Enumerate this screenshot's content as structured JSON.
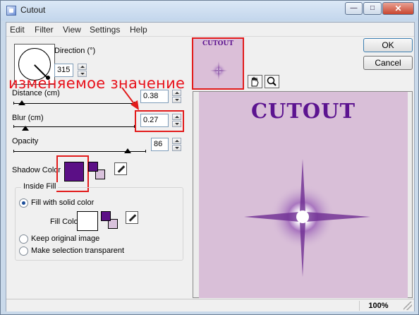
{
  "window": {
    "title": "Cutout"
  },
  "menu": [
    "Edit",
    "Filter",
    "View",
    "Settings",
    "Help"
  ],
  "direction": {
    "label": "Direction (°)",
    "value": "315"
  },
  "annotation": "изменяемое значение",
  "distance": {
    "label": "Distance (cm)",
    "value": "0.38"
  },
  "blur": {
    "label": "Blur (cm)",
    "value": "0.27"
  },
  "opacity": {
    "label": "Opacity",
    "value": "86"
  },
  "shadow_color": {
    "label": "Shadow Color",
    "color": "#5b0f86"
  },
  "inside_fill": {
    "title": "Inside Fill",
    "options": [
      "Fill with solid color",
      "Keep original image",
      "Make selection transparent"
    ],
    "selected": 0,
    "fill_color_label": "Fill Color",
    "fill_color": "#ffffff"
  },
  "preview": {
    "thumb_text": "CUTOUT",
    "text": "CUTOUT",
    "text_color": "#5c1490",
    "background": "#d9bfd8"
  },
  "buttons": {
    "ok": "OK",
    "cancel": "Cancel"
  },
  "status": {
    "zoom": "100%"
  },
  "icons": [
    "hand-icon",
    "zoom-icon",
    "eyedropper-icon"
  ]
}
